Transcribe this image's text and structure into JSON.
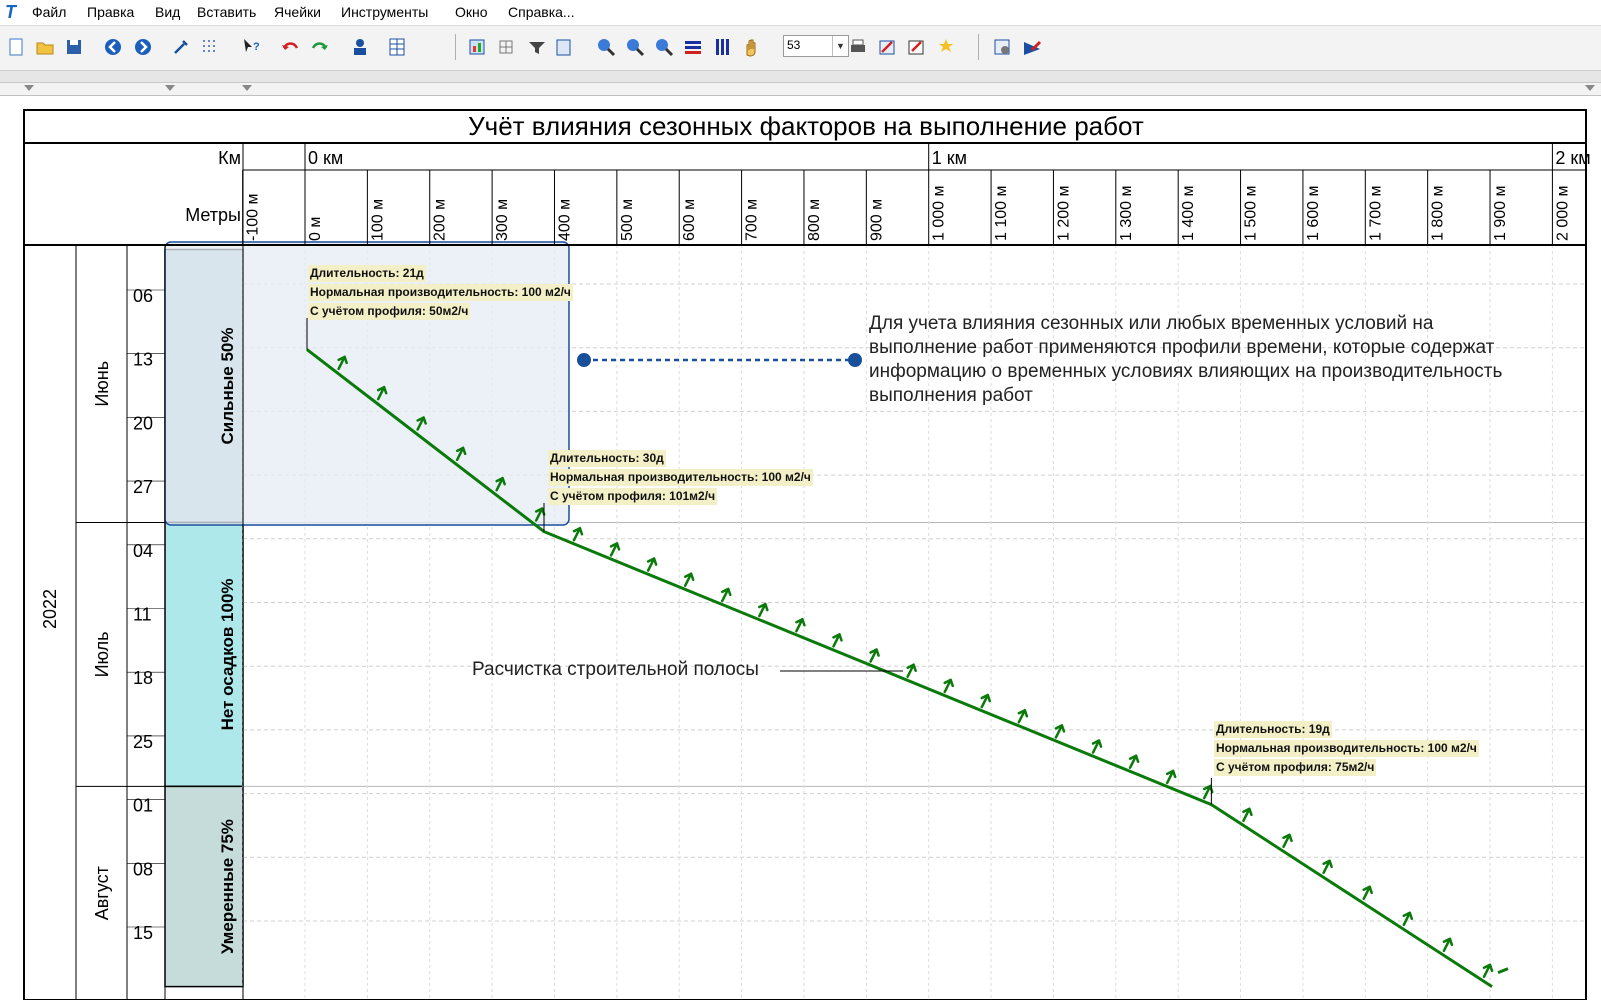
{
  "app": {
    "menu": [
      "Файл",
      "Правка",
      "Вид",
      "Вставить",
      "Ячейки",
      "Инструменты",
      "Окно",
      "Справка..."
    ],
    "toolbar": {
      "zoom_value": "53"
    }
  },
  "chart_data": {
    "type": "line",
    "title": "Учёт влияния сезонных факторов на выполнение работ",
    "x_axis": {
      "km_label": "Км",
      "m_label": "Метры",
      "km_ticks": [
        "0 км",
        "1 км",
        "2 км"
      ],
      "m_ticks": [
        "-100 м",
        "0 м",
        "100 м",
        "200 м",
        "300 м",
        "400 м",
        "500 м",
        "600 м",
        "700 м",
        "800 м",
        "900 м",
        "1 000 м",
        "1 100 м",
        "1 200 м",
        "1 300 м",
        "1 400 м",
        "1 500 м",
        "1 600 м",
        "1 700 м",
        "1 800 м",
        "1 900 м",
        "2 000 м"
      ],
      "range_m": [
        -100,
        2000
      ]
    },
    "y_axis": {
      "year": "2022",
      "months": [
        "Июнь",
        "Июль",
        "Август"
      ],
      "weeks": [
        "06",
        "13",
        "20",
        "27",
        "04",
        "11",
        "18",
        "25",
        "01",
        "08",
        "15"
      ],
      "range_date": [
        "2022-06-01",
        "2022-08-18"
      ]
    },
    "profiles": [
      {
        "label": "Сильные 50%",
        "color": "#b4cfd5"
      },
      {
        "label": "Нет осадков 100%",
        "color": "#aee8ea"
      },
      {
        "label": "Умеренные 75%",
        "color": "#c5dcdb"
      }
    ],
    "series": [
      {
        "name": "Расчистка строительной полосы",
        "points": [
          {
            "x": 0,
            "date": "2022-06-12"
          },
          {
            "x": 380,
            "date": "2022-07-02"
          },
          {
            "x": 1450,
            "date": "2022-08-01"
          },
          {
            "x": 1900,
            "date": "2022-08-21"
          }
        ]
      }
    ],
    "annotations": [
      {
        "lines": [
          "Длительность: 21д",
          "Нормальная производительность: 100 м2/ч",
          "С учётом профиля: 50м2/ч"
        ]
      },
      {
        "lines": [
          "Длительность: 30д",
          "Нормальная производительность: 100 м2/ч",
          "С учётом профиля: 101м2/ч"
        ]
      },
      {
        "lines": [
          "Длительность: 19д",
          "Нормальная производительность: 100 м2/ч",
          "С учётом профиля: 75м2/ч"
        ]
      }
    ],
    "task_label": "Расчистка строительной полосы",
    "note": "Для учета влияния сезонных или любых временных условий на выполнение работ применяются профили времени, которые содержат информацию о временных условиях влияющих на производительность выполнения работ",
    "colors": {
      "task_line": "#0a7a0a",
      "highlight_border": "#1a4f9c",
      "connector": "#1a4f9c",
      "callout_bg": "#f3f0c8"
    }
  }
}
